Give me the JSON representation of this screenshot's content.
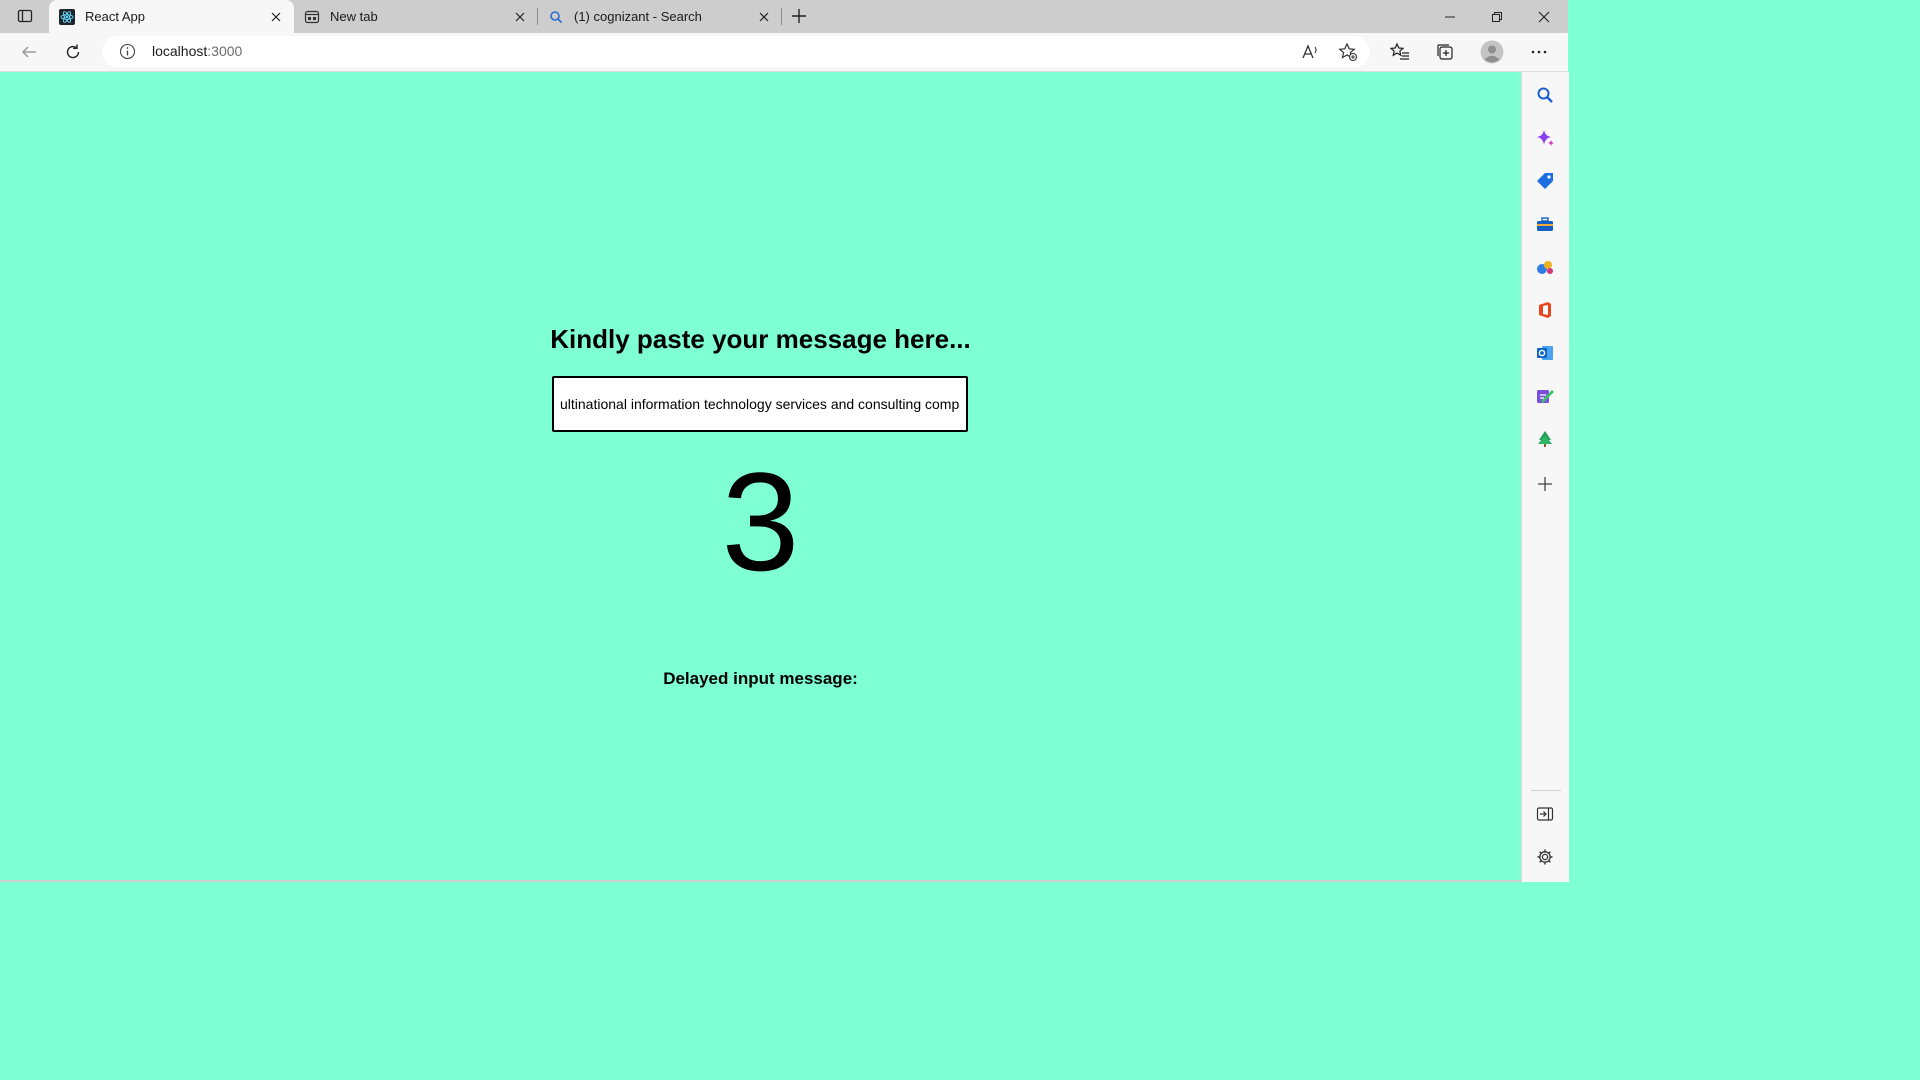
{
  "browser": {
    "tabs": [
      {
        "label": "React App",
        "icon": "react-logo-icon",
        "active": true
      },
      {
        "label": "New tab",
        "icon": "new-tab-page-icon",
        "active": false
      },
      {
        "label": "(1) cognizant - Search",
        "icon": "search-icon",
        "active": false
      }
    ],
    "address": {
      "host": "localhost",
      "port": ":3000"
    }
  },
  "page": {
    "heading": "Kindly paste your message here...",
    "input_value": "ultinational information technology services and consulting company.",
    "counter": "3",
    "delayed_label": "Delayed input message:"
  },
  "colors": {
    "page_background": "#7fffd4",
    "tabstrip": "#cdcdcd",
    "toolbar": "#f7f7f7"
  }
}
